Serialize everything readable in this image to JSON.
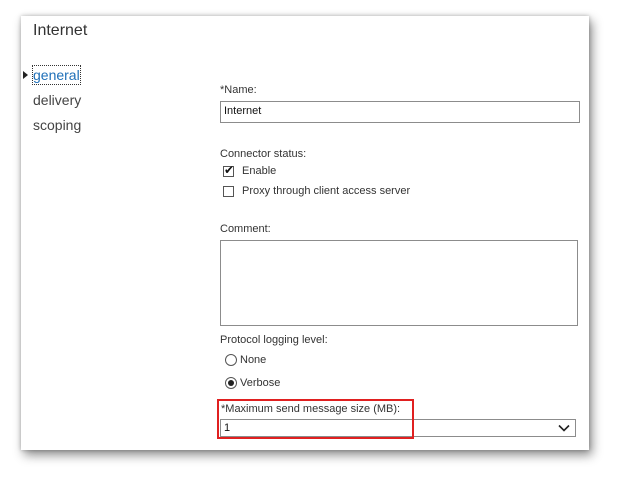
{
  "window": {
    "title": "Internet"
  },
  "nav": {
    "items": [
      {
        "label": "general",
        "active": true
      },
      {
        "label": "delivery",
        "active": false
      },
      {
        "label": "scoping",
        "active": false
      }
    ]
  },
  "form": {
    "name_label": "*Name:",
    "name_value": "Internet",
    "connector_status_label": "Connector status:",
    "enable_label": "Enable",
    "enable_checked": true,
    "proxy_label": "Proxy through client access server",
    "proxy_checked": false,
    "comment_label": "Comment:",
    "comment_value": "",
    "protocol_logging_label": "Protocol logging level:",
    "logging_options": [
      {
        "label": "None",
        "selected": false
      },
      {
        "label": "Verbose",
        "selected": true
      }
    ],
    "max_size_label": "*Maximum send message size (MB):",
    "max_size_value": "1"
  },
  "colors": {
    "accent_link": "#1e6fb8",
    "highlight_border": "#e02020"
  },
  "icons": {
    "nav_active": "caret-right-icon",
    "enable_check": "checkmark-icon",
    "select_dropdown": "chevron-down-icon"
  }
}
